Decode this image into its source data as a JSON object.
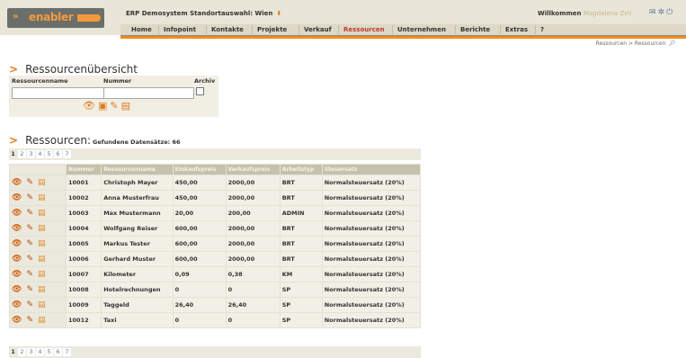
{
  "header": {
    "logo_text": "enabler",
    "system_label": "ERP Demosystem Standortauswahl: Wien",
    "welcome_label": "Willkommen",
    "user_name": "Magdalena Zell",
    "icons": [
      "mail-icon",
      "settings-icon",
      "power-icon"
    ]
  },
  "nav": {
    "items": [
      "Home",
      "Infopoint",
      "Kontakte",
      "Projekte",
      "Verkauf",
      "Ressourcen",
      "Unternehmen",
      "Berichte",
      "Extras",
      "?"
    ],
    "active": "Ressourcen"
  },
  "breadcrumb": "Ressourcen > Ressourcen",
  "overview": {
    "title": "Ressourcenübersicht",
    "name_label": "Ressourcenname",
    "number_label": "Nummer",
    "archive_label": "Archiv",
    "name_value": "",
    "number_value": "",
    "action_icons": [
      "view-icon",
      "new-icon",
      "tools-icon",
      "export-icon"
    ]
  },
  "results": {
    "title": "Ressourcen:",
    "found_text": "Gefundene Datensätze: 66",
    "pages": [
      "1",
      "2",
      "3",
      "4",
      "5",
      "6",
      "7"
    ],
    "current_page": "1",
    "columns": [
      "Nummer",
      "Ressourcenname",
      "Einkaufspreis",
      "Verkaufspreis",
      "Arbeitstyp",
      "Steuersatz"
    ],
    "rows": [
      [
        "10001",
        "Christoph Mayer",
        "450,00",
        "2000,00",
        "BRT",
        "Normalsteuersatz (20%)"
      ],
      [
        "10002",
        "Anna Musterfrau",
        "450,00",
        "2000,00",
        "BRT",
        "Normalsteuersatz (20%)"
      ],
      [
        "10003",
        "Max Mustermann",
        "20,00",
        "200,00",
        "ADMIN",
        "Normalsteuersatz (20%)"
      ],
      [
        "10004",
        "Wolfgang Reiser",
        "600,00",
        "2000,00",
        "BRT",
        "Normalsteuersatz (20%)"
      ],
      [
        "10005",
        "Markus Tester",
        "600,00",
        "2000,00",
        "BRT",
        "Normalsteuersatz (20%)"
      ],
      [
        "10006",
        "Gerhard Muster",
        "600,00",
        "2000,00",
        "BRT",
        "Normalsteuersatz (20%)"
      ],
      [
        "10007",
        "Kilometer",
        "0,09",
        "0,38",
        "KM",
        "Normalsteuersatz (20%)"
      ],
      [
        "10008",
        "Hotelrechnungen",
        "0",
        "0",
        "SP",
        "Normalsteuersatz (20%)"
      ],
      [
        "10009",
        "Taggeld",
        "26,40",
        "26,40",
        "SP",
        "Normalsteuersatz (20%)"
      ],
      [
        "10012",
        "Taxi",
        "0",
        "0",
        "SP",
        "Normalsteuersatz (20%)"
      ]
    ]
  }
}
